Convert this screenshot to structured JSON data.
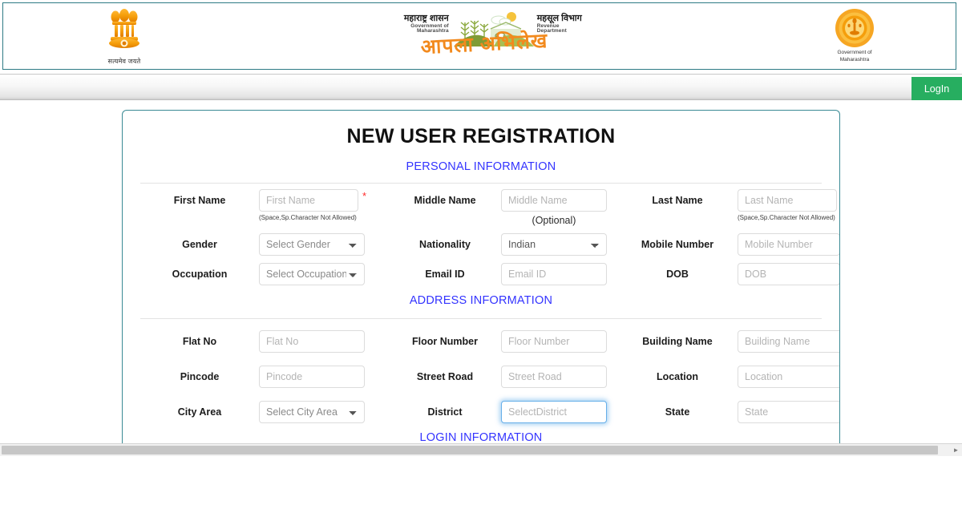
{
  "header": {
    "emblem_left": {
      "icon": "india-state-emblem-icon",
      "caption": "सत्यमेव जयते"
    },
    "center_logo": {
      "marathi_left": "महाराष्ट्र शासन",
      "english_left": "Government of Maharashtra",
      "marathi_right": "महसूल विभाग",
      "english_right": "Revenue Department",
      "wordmark": "आपला अभिलेख",
      "icon": "farm-scene-icon"
    },
    "emblem_right": {
      "icon": "maharashtra-government-seal-icon",
      "caption_line1": "Government of",
      "caption_line2": "Maharashtra"
    }
  },
  "nav": {
    "login_label": "LogIn"
  },
  "form": {
    "title": "NEW USER REGISTRATION",
    "sections": {
      "personal": "PERSONAL INFORMATION",
      "address": "ADDRESS INFORMATION",
      "login": "LOGIN INFORMATION"
    },
    "hints": {
      "no_space_special": "(Space,Sp.Character Not Allowed)",
      "optional": "(Optional)"
    },
    "fields": {
      "first_name": {
        "label": "First Name",
        "placeholder": "First Name",
        "value": "",
        "required": true
      },
      "middle_name": {
        "label": "Middle Name",
        "placeholder": "Middle Name",
        "value": "",
        "required": false
      },
      "last_name": {
        "label": "Last Name",
        "placeholder": "Last Name",
        "value": "",
        "required": true
      },
      "gender": {
        "label": "Gender",
        "selected": "Select Gender",
        "required": false
      },
      "nationality": {
        "label": "Nationality",
        "selected": "Indian",
        "required": false
      },
      "mobile_number": {
        "label": "Mobile Number",
        "placeholder": "Mobile Number",
        "value": "",
        "required": true
      },
      "occupation": {
        "label": "Occupation",
        "selected": "Select Occupation",
        "required": false
      },
      "email_id": {
        "label": "Email ID",
        "placeholder": "Email ID",
        "value": "",
        "required": false
      },
      "dob": {
        "label": "DOB",
        "placeholder": "DOB",
        "value": "",
        "required": true
      },
      "flat_no": {
        "label": "Flat No",
        "placeholder": "Flat No",
        "value": "",
        "required": false
      },
      "floor_number": {
        "label": "Floor Number",
        "placeholder": "Floor Number",
        "value": "",
        "required": false
      },
      "building_name": {
        "label": "Building Name",
        "placeholder": "Building Name",
        "value": "",
        "required": false
      },
      "pincode": {
        "label": "Pincode",
        "placeholder": "Pincode",
        "value": "",
        "required": false
      },
      "street_road": {
        "label": "Street Road",
        "placeholder": "Street Road",
        "value": "",
        "required": false
      },
      "location": {
        "label": "Location",
        "placeholder": "Location",
        "value": "",
        "required": false
      },
      "city_area": {
        "label": "City Area",
        "selected": "Select City Area",
        "required": false
      },
      "district": {
        "label": "District",
        "placeholder": "SelectDistrict",
        "value": "",
        "required": false,
        "focused": true
      },
      "state": {
        "label": "State",
        "placeholder": "State",
        "value": "",
        "required": false
      }
    }
  },
  "scrollbar": {
    "left_arrow": "◄",
    "right_arrow": "►"
  },
  "colors": {
    "accent_teal": "#3a8a94",
    "section_blue": "#3333ff",
    "login_green": "#27ae60",
    "required_red": "#ff2a2a",
    "saffron": "#f28a1e"
  }
}
